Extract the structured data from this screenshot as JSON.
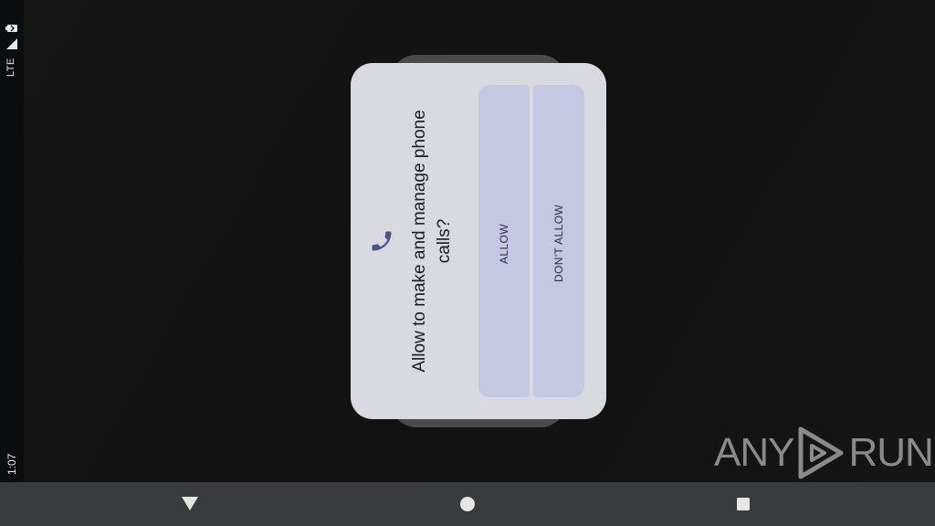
{
  "status_bar": {
    "network": "LTE",
    "time": "1:07",
    "signal_icon": "signal-icon",
    "battery_icon": "battery-icon"
  },
  "dialog": {
    "icon": "phone-icon",
    "message": "Allow to make and manage phone calls?",
    "allow_label": "ALLOW",
    "deny_label": "DON'T ALLOW"
  },
  "nav_bar": {
    "back_icon": "back-triangle-icon",
    "home_icon": "home-circle-icon",
    "recents_icon": "recents-square-icon"
  },
  "watermark": {
    "left": "ANY",
    "right": "RUN"
  },
  "colors": {
    "dialog_bg": "#d9d9e1",
    "button_bg": "#c4c9e2",
    "accent": "#4a5688",
    "nav_bg": "#393b3e"
  }
}
